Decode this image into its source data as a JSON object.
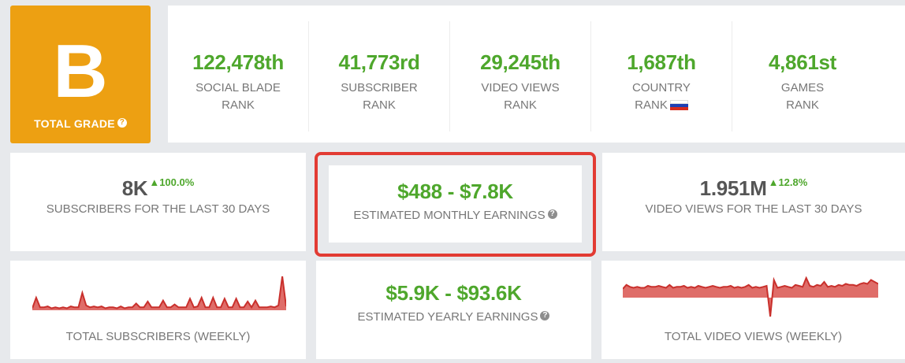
{
  "grade": {
    "letter": "B",
    "label": "TOTAL GRADE",
    "help": "?"
  },
  "ranks": [
    {
      "value": "122,478th",
      "line1": "SOCIAL BLADE",
      "line2": "RANK"
    },
    {
      "value": "41,773rd",
      "line1": "SUBSCRIBER",
      "line2": "RANK"
    },
    {
      "value": "29,245th",
      "line1": "VIDEO VIEWS",
      "line2": "RANK"
    },
    {
      "value": "1,687th",
      "line1": "COUNTRY",
      "line2": "RANK",
      "flag": "russia-flag-icon"
    },
    {
      "value": "4,861st",
      "line1": "GAMES",
      "line2": "RANK"
    }
  ],
  "subs30": {
    "value": "8K",
    "delta": "100.0%",
    "label": "SUBSCRIBERS FOR THE LAST 30 DAYS"
  },
  "monthly": {
    "value": "$488 - $7.8K",
    "label": "ESTIMATED MONTHLY EARNINGS",
    "help": "?"
  },
  "views30": {
    "value": "1.951M",
    "delta": "12.8%",
    "label": "VIDEO VIEWS FOR THE LAST 30 DAYS"
  },
  "yearly": {
    "value": "$5.9K - $93.6K",
    "label": "ESTIMATED YEARLY EARNINGS",
    "help": "?"
  },
  "subsWeekly": {
    "label": "TOTAL SUBSCRIBERS (WEEKLY)",
    "series": [
      2,
      13,
      3,
      3,
      4,
      2,
      3,
      2,
      3,
      2,
      4,
      3,
      3,
      18,
      5,
      3,
      4,
      3,
      4,
      2,
      3,
      3,
      2,
      4,
      2,
      3,
      3,
      7,
      3,
      3,
      9,
      3,
      3,
      3,
      10,
      3,
      3,
      6,
      3,
      3,
      3,
      12,
      3,
      4,
      13,
      3,
      3,
      13,
      3,
      3,
      12,
      3,
      3,
      12,
      3,
      3,
      9,
      3,
      10,
      3,
      3,
      3,
      4,
      3,
      5,
      35,
      4
    ]
  },
  "viewsWeekly": {
    "label": "TOTAL VIDEO VIEWS (WEEKLY)",
    "series": [
      9,
      13,
      11,
      10,
      11,
      10,
      10,
      12,
      11,
      11,
      12,
      11,
      10,
      13,
      10,
      11,
      11,
      12,
      10,
      11,
      10,
      12,
      11,
      10,
      11,
      12,
      11,
      10,
      11,
      11,
      12,
      10,
      11,
      10,
      11,
      13,
      10,
      11,
      10,
      11,
      12,
      -14,
      18,
      10,
      11,
      12,
      11,
      10,
      13,
      12,
      11,
      20,
      12,
      11,
      13,
      12,
      16,
      11,
      12,
      11,
      13,
      12,
      14,
      13,
      13,
      12,
      14,
      15,
      14,
      18,
      16,
      14
    ]
  },
  "colors": {
    "green": "#4ea72c",
    "orange": "#eda012",
    "red": "#d9534f",
    "highlight": "#e23b33"
  }
}
